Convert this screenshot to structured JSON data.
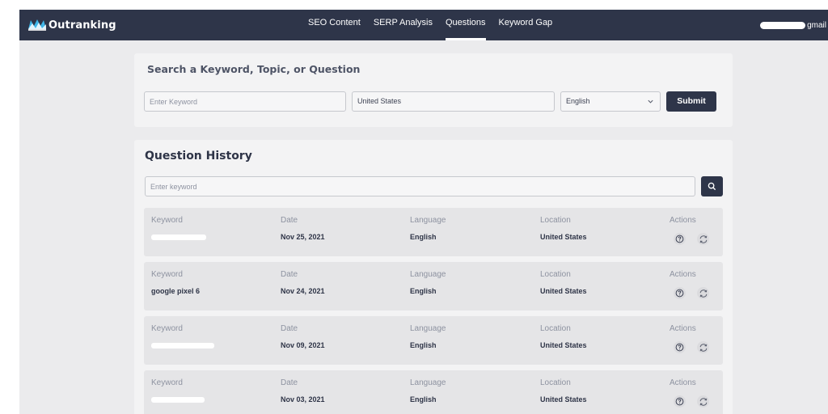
{
  "app": {
    "brand": "Outranking"
  },
  "nav": {
    "items": [
      {
        "label": "SEO Content",
        "active": false
      },
      {
        "label": "SERP Analysis",
        "active": false
      },
      {
        "label": "Questions",
        "active": true
      },
      {
        "label": "Keyword Gap",
        "active": false
      }
    ],
    "user_email_suffix": "gmail"
  },
  "search": {
    "title": "Search a Keyword, Topic, or Question",
    "keyword_placeholder": "Enter Keyword",
    "location_value": "United States",
    "language_value": "English",
    "submit_label": "Submit"
  },
  "history": {
    "title": "Question History",
    "search_placeholder": "Enter keyword",
    "columns": {
      "keyword": "Keyword",
      "date": "Date",
      "language": "Language",
      "location": "Location",
      "actions": "Actions"
    },
    "rows": [
      {
        "keyword": "",
        "keyword_redacted": true,
        "date": "Nov 25, 2021",
        "language": "English",
        "location": "United States"
      },
      {
        "keyword": "google pixel 6",
        "keyword_redacted": false,
        "date": "Nov 24, 2021",
        "language": "English",
        "location": "United States"
      },
      {
        "keyword": "",
        "keyword_redacted": true,
        "date": "Nov 09, 2021",
        "language": "English",
        "location": "United States"
      },
      {
        "keyword": "",
        "keyword_redacted": true,
        "date": "Nov 03, 2021",
        "language": "English",
        "location": "United States"
      }
    ]
  },
  "icons": {
    "search": "search-icon",
    "chevron": "chevron-down-icon",
    "help": "question-circle-icon",
    "refresh": "refresh-icon"
  },
  "colors": {
    "navbar": "#2e3549",
    "primary_button": "#2e3549",
    "logo_accent": "#3fb6e8",
    "page_bg": "#ebebed"
  }
}
